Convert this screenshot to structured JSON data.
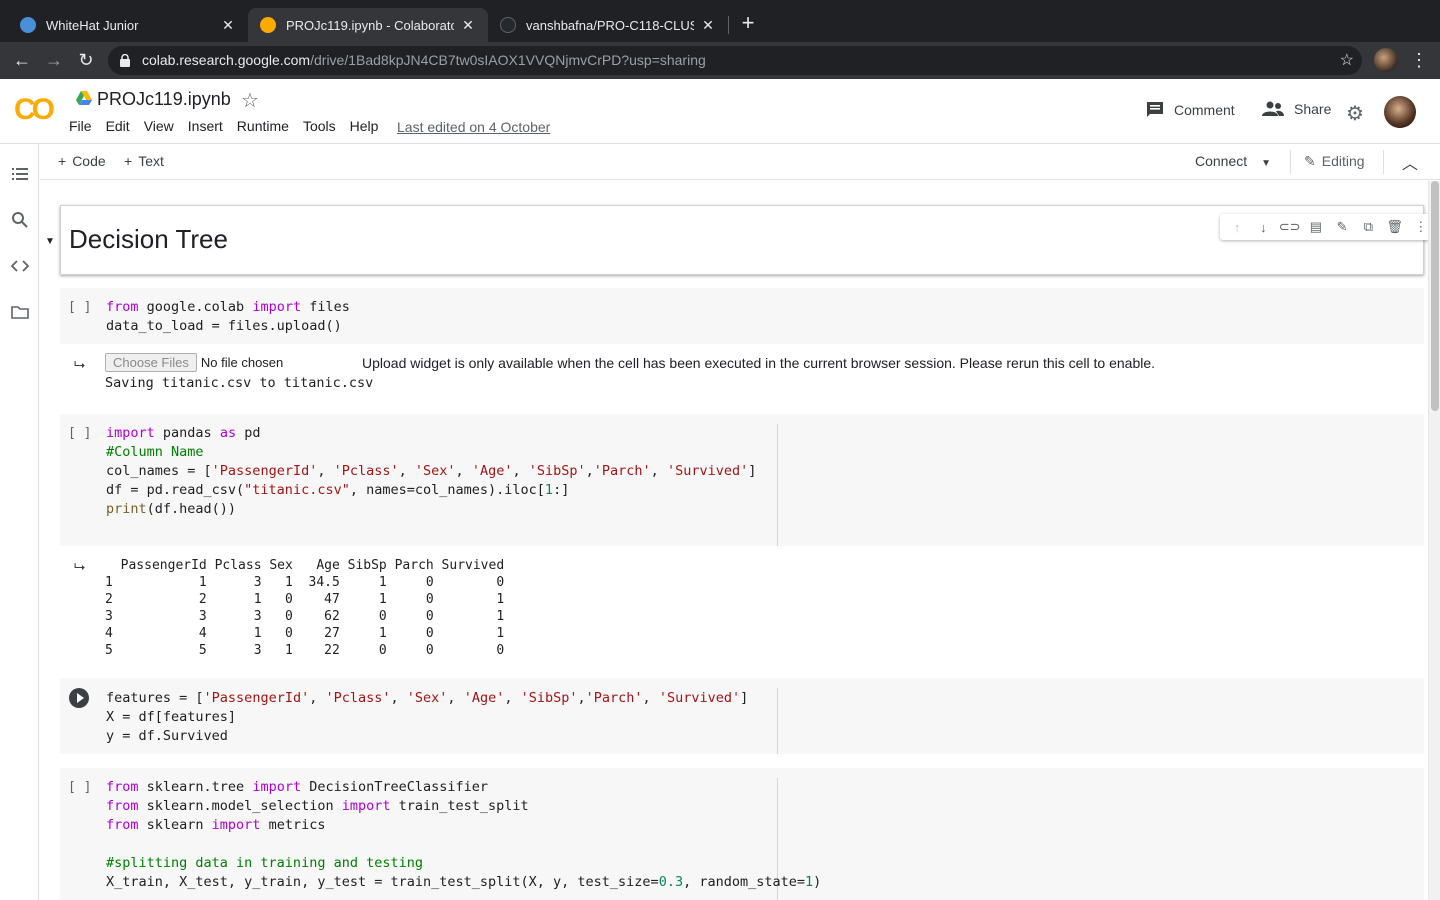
{
  "browser": {
    "tabs": [
      {
        "title": "WhiteHat Junior",
        "active": false
      },
      {
        "title": "PROJc119.ipynb - Colaboratory",
        "active": true
      },
      {
        "title": "vanshbafna/PRO-C118-CLUSTE",
        "active": false
      }
    ],
    "url_host": "colab.research.google.com",
    "url_path": "/drive/1Bad8kpJN4CB7tw0sIAOX1VVQNjmvCrPD?usp=sharing"
  },
  "colab": {
    "logo": "CO",
    "title": "PROJc119.ipynb",
    "menu": [
      "File",
      "Edit",
      "View",
      "Insert",
      "Runtime",
      "Tools",
      "Help"
    ],
    "last_edited": "Last edited on 4 October",
    "comment_label": "Comment",
    "share_label": "Share"
  },
  "toolbar": {
    "add_code": "Code",
    "add_text": "Text",
    "connect": "Connect",
    "editing": "Editing"
  },
  "cells": {
    "heading": "Decision Tree",
    "bracket": "[ ]",
    "upload": {
      "button": "Choose Files",
      "no_file": "No file chosen",
      "message": "Upload widget is only available when the cell has been executed in the current browser session. Please rerun this cell to enable.",
      "saving": "Saving titanic.csv to titanic.csv"
    },
    "df_output": "  PassengerId Pclass Sex   Age SibSp Parch Survived\n1           1      3   1  34.5     1     0        0\n2           2      1   0    47     1     0        1\n3           3      3   0    62     0     0        1\n4           4      1   0    27     1     0        1\n5           5      3   1    22     0     0        0"
  }
}
